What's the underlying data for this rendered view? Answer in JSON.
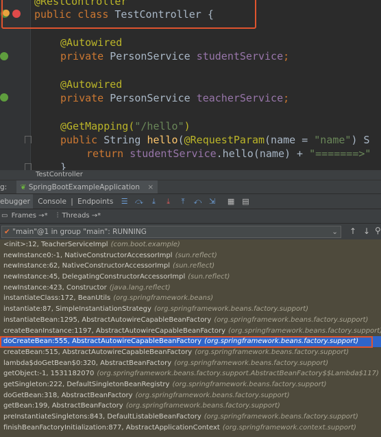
{
  "editor": {
    "lines": [
      {
        "parts": [
          {
            "t": "@RestController",
            "c": "ann"
          }
        ]
      },
      {
        "parts": [
          {
            "t": "public ",
            "c": "kw"
          },
          {
            "t": "class ",
            "c": "kw"
          },
          {
            "t": "TestController {",
            "c": ""
          }
        ]
      },
      {
        "parts": [
          {
            "t": "@Autowired",
            "c": "ann"
          }
        ]
      },
      {
        "parts": [
          {
            "t": "private ",
            "c": "kw"
          },
          {
            "t": "PersonService ",
            "c": ""
          },
          {
            "t": "studentService",
            "c": "field"
          },
          {
            "t": ";",
            "c": "kw"
          }
        ]
      },
      {
        "parts": [
          {
            "t": "@Autowired",
            "c": "ann"
          }
        ]
      },
      {
        "parts": [
          {
            "t": "private ",
            "c": "kw"
          },
          {
            "t": "PersonService ",
            "c": ""
          },
          {
            "t": "teacherService",
            "c": "field"
          },
          {
            "t": ";",
            "c": "kw"
          }
        ]
      },
      {
        "parts": [
          {
            "t": "@GetMapping(",
            "c": "ann"
          },
          {
            "t": "\"/hello\"",
            "c": "str"
          },
          {
            "t": ")",
            "c": "ann"
          }
        ]
      },
      {
        "parts": [
          {
            "t": "public ",
            "c": "kw"
          },
          {
            "t": "String ",
            "c": ""
          },
          {
            "t": "hello",
            "c": "fn"
          },
          {
            "t": "(",
            "c": ""
          },
          {
            "t": "@RequestParam",
            "c": "ann"
          },
          {
            "t": "(name = ",
            "c": ""
          },
          {
            "t": "\"name\"",
            "c": "str"
          },
          {
            "t": ") S",
            "c": ""
          }
        ]
      },
      {
        "parts": [
          {
            "t": "return ",
            "c": "kw"
          },
          {
            "t": "studentService",
            "c": "field"
          },
          {
            "t": ".hello(name) + ",
            "c": ""
          },
          {
            "t": "\"=======>\"",
            "c": "str"
          }
        ]
      },
      {
        "parts": [
          {
            "t": "}",
            "c": ""
          }
        ]
      }
    ]
  },
  "file_tab": {
    "label": "TestController"
  },
  "run_bar": {
    "prefix": "g:",
    "config": "SpringBootExampleApplication",
    "close": "×"
  },
  "debugger_tabs": {
    "debugger": "ebugger",
    "console": "Console",
    "endpoints": "Endpoints",
    "separator": "|"
  },
  "frames_bar": {
    "frames": "Frames →*",
    "threads": "Threads →*"
  },
  "thread": {
    "selected": "\"main\"@1 in group \"main\": RUNNING"
  },
  "frames": [
    {
      "method": "<init>:12, TeacherServiceImpl",
      "pkg": "(com.boot.example)"
    },
    {
      "method": "newInstance0:-1, NativeConstructorAccessorImpl",
      "pkg": "(sun.reflect)"
    },
    {
      "method": "newInstance:62, NativeConstructorAccessorImpl",
      "pkg": "(sun.reflect)"
    },
    {
      "method": "newInstance:45, DelegatingConstructorAccessorImpl",
      "pkg": "(sun.reflect)"
    },
    {
      "method": "newInstance:423, Constructor",
      "pkg": "(java.lang.reflect)"
    },
    {
      "method": "instantiateClass:172, BeanUtils",
      "pkg": "(org.springframework.beans)"
    },
    {
      "method": "instantiate:87, SimpleInstantiationStrategy",
      "pkg": "(org.springframework.beans.factory.support)"
    },
    {
      "method": "instantiateBean:1295, AbstractAutowireCapableBeanFactory",
      "pkg": "(org.springframework.beans.factory.support)"
    },
    {
      "method": "createBeanInstance:1197, AbstractAutowireCapableBeanFactory",
      "pkg": "(org.springframework.beans.factory.support)"
    },
    {
      "method": "doCreateBean:555, AbstractAutowireCapableBeanFactory",
      "pkg": "(org.springframework.beans.factory.support)",
      "selected": true
    },
    {
      "method": "createBean:515, AbstractAutowireCapableBeanFactory",
      "pkg": "(org.springframework.beans.factory.support)"
    },
    {
      "method": "lambda$doGetBean$0:320, AbstractBeanFactory",
      "pkg": "(org.springframework.beans.factory.support)"
    },
    {
      "method": "getObject:-1, 1531182070",
      "pkg": "(org.springframework.beans.factory.support.AbstractBeanFactory$$Lambda$117)"
    },
    {
      "method": "getSingleton:222, DefaultSingletonBeanRegistry",
      "pkg": "(org.springframework.beans.factory.support)"
    },
    {
      "method": "doGetBean:318, AbstractBeanFactory",
      "pkg": "(org.springframework.beans.factory.support)"
    },
    {
      "method": "getBean:199, AbstractBeanFactory",
      "pkg": "(org.springframework.beans.factory.support)"
    },
    {
      "method": "preInstantiateSingletons:843, DefaultListableBeanFactory",
      "pkg": "(org.springframework.beans.factory.support)"
    },
    {
      "method": "finishBeanFactoryInitialization:877, AbstractApplicationContext",
      "pkg": "(org.springframework.context.support)"
    }
  ],
  "colors": {
    "accent_red": "#e0542e",
    "selection": "#2f65ca",
    "frames_bg": "#4e4a3c"
  }
}
